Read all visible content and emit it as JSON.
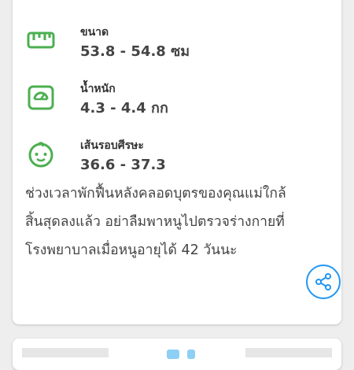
{
  "stats": [
    {
      "label": "ขนาด",
      "value": "53.8 - 54.8 ซม",
      "icon": "ruler-icon"
    },
    {
      "label": "น้ำหนัก",
      "value": "4.3 - 4.4 กก",
      "icon": "scale-icon"
    },
    {
      "label": "เส้นรอบศีรษะ",
      "value": "36.6 - 37.3",
      "icon": "baby-face-icon"
    }
  ],
  "description": {
    "line1": "ช่วงเวลาพักฟื้นหลังคลอดบุตรของคุณแม่ใกล้",
    "line2": "สิ้นสุดลงแล้ว อย่าลืมพาหนูไปตรวจร่างกายที่",
    "line3": "โรงพยาบาลเมื่อหนูอายุได้ 42 วันนะ"
  },
  "colors": {
    "accent": "#2196f3",
    "icon_green": "#4caf50"
  }
}
